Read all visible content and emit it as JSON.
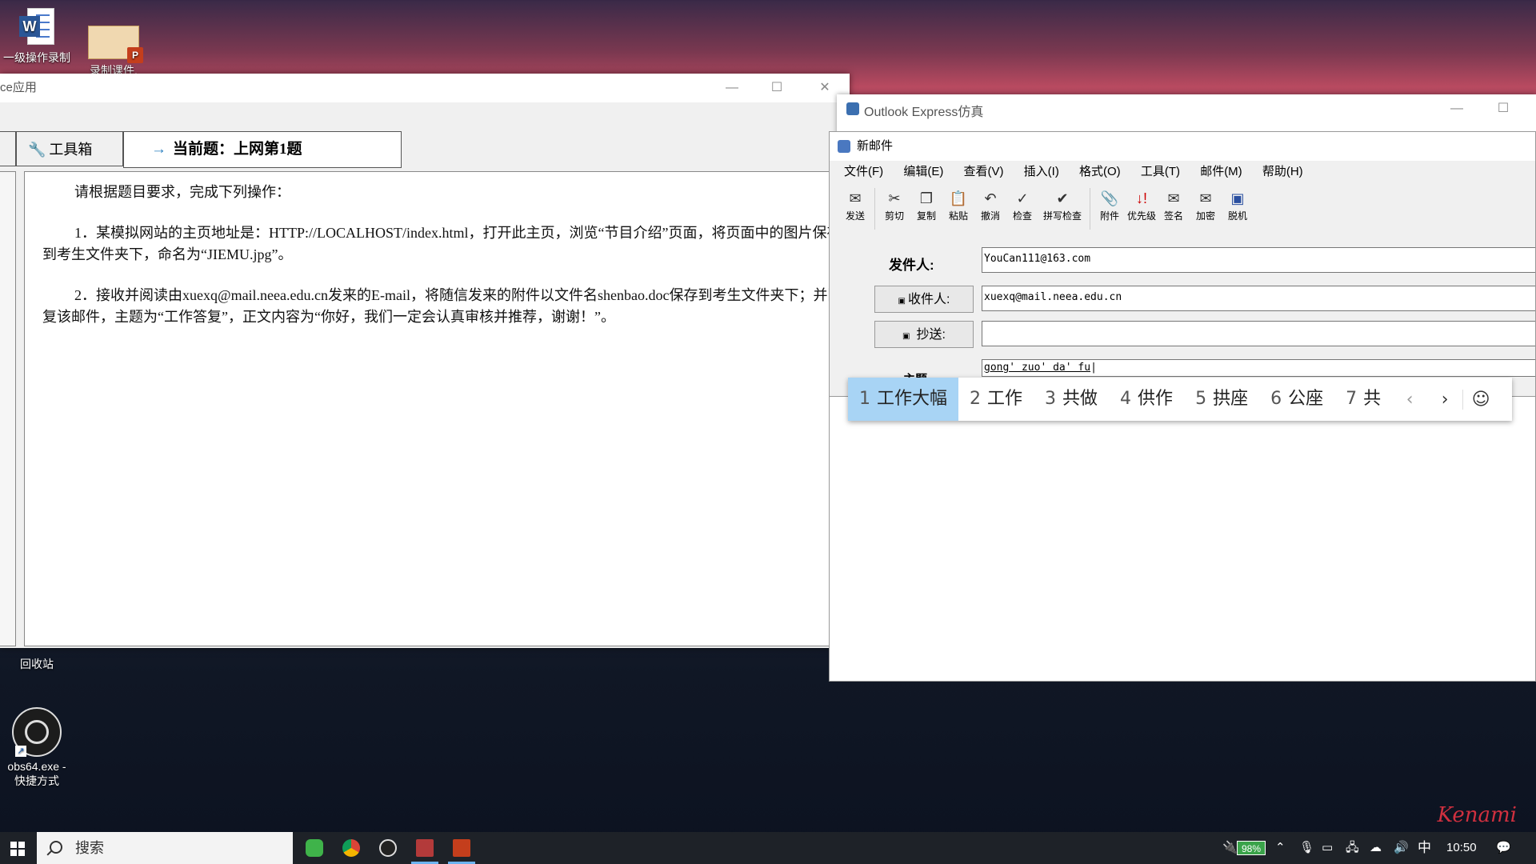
{
  "desktop": {
    "icons": [
      {
        "label": "一级操作录制",
        "type": "word"
      },
      {
        "label": "录制课件.",
        "type": "ppt"
      },
      {
        "label": "回收站",
        "type": "recycle"
      },
      {
        "label_line1": "obs64.exe -",
        "label_line2": "快捷方式",
        "type": "obs"
      }
    ],
    "signature": "Kenami"
  },
  "left_window": {
    "title": "ce应用",
    "toolbox_label": "工具箱",
    "current_label": "当前题：上网第1题",
    "intro": "请根据题目要求，完成下列操作：",
    "q1": "1．某模拟网站的主页地址是：HTTP://LOCALHOST/index.html，打开此主页，浏览“节目介绍”页面，将页面中的图片保存到考生文件夹下，命名为“JIEMU.jpg”。",
    "q2": "2．接收并阅读由xuexq@mail.neea.edu.cn发来的E-mail，将随信发来的附件以文件名shenbao.doc保存到考生文件夹下；并回复该邮件，主题为“工作答复”，正文内容为“你好，我们一定会认真审核并推荐，谢谢！”。"
  },
  "outlook": {
    "title": "Outlook Express仿真",
    "compose_title": "新邮件",
    "menu": [
      "文件(F)",
      "编辑(E)",
      "查看(V)",
      "插入(I)",
      "格式(O)",
      "工具(T)",
      "邮件(M)",
      "帮助(H)"
    ],
    "toolbar": [
      {
        "label": "发送",
        "icon": "send-icon"
      },
      {
        "label": "剪切",
        "icon": "scissors-icon"
      },
      {
        "label": "复制",
        "icon": "copy-icon"
      },
      {
        "label": "粘贴",
        "icon": "paste-icon"
      },
      {
        "label": "撤消",
        "icon": "undo-icon"
      },
      {
        "label": "检查",
        "icon": "check-names-icon"
      },
      {
        "label": "拼写检查",
        "icon": "spellcheck-icon"
      },
      {
        "label": "附件",
        "icon": "paperclip-icon"
      },
      {
        "label": "优先级",
        "icon": "priority-icon"
      },
      {
        "label": "签名",
        "icon": "sign-icon"
      },
      {
        "label": "加密",
        "icon": "encrypt-icon"
      },
      {
        "label": "脱机",
        "icon": "offline-icon"
      }
    ],
    "from_label": "发件人:",
    "from_value": "YouCan111@163.com",
    "to_label": "收件人:",
    "to_value": "xuexq@mail.neea.edu.cn",
    "cc_label": "抄送:",
    "cc_value": "",
    "subject_label": "主题",
    "subject_value": "gong' zuo' da' fu"
  },
  "ime": {
    "candidates": [
      {
        "n": "1",
        "text": "工作大幅",
        "selected": true
      },
      {
        "n": "2",
        "text": "工作"
      },
      {
        "n": "3",
        "text": "共做"
      },
      {
        "n": "4",
        "text": "供作"
      },
      {
        "n": "5",
        "text": "拱座"
      },
      {
        "n": "6",
        "text": "公座"
      },
      {
        "n": "7",
        "text": "共"
      }
    ]
  },
  "taskbar": {
    "search_placeholder": "搜索",
    "battery": "98%",
    "ime_indicator": "中",
    "time": "10:50"
  }
}
